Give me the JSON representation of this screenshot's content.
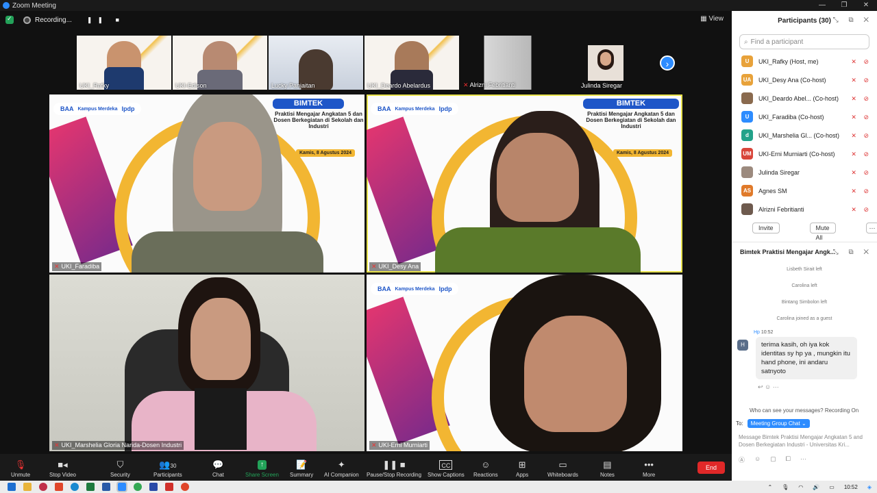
{
  "window": {
    "title": "Zoom Meeting"
  },
  "topbar": {
    "recording_label": "Recording...",
    "view_label": "View"
  },
  "strip": [
    {
      "name": "UKI_Rafky"
    },
    {
      "name": "UKI-Edison"
    },
    {
      "name": "Lucky Panjaitan"
    },
    {
      "name": "UKI_Deardo Abelardus"
    },
    {
      "name": "Alrizni Febritianti"
    },
    {
      "name": "Julinda Siregar"
    }
  ],
  "tiles": [
    {
      "name": "UKI_Faradiba"
    },
    {
      "name": "UKI_Desy Ana"
    },
    {
      "name": "UKI_Marshelia Gloria Narida-Dosen Industri"
    },
    {
      "name": "UKI-Erni Murniarti"
    }
  ],
  "slide": {
    "banner": "BIMTEK",
    "subtitle": "Praktisi Mengajar Angkatan 5 dan Dosen Berkegiatan di Sekolah dan Industri",
    "date": "Kamis, 8 Agustus 2024",
    "logo_baa": "BAA",
    "logo_km": "Kampus Merdeka",
    "logo_lpdp": "lpdp"
  },
  "participants": {
    "title": "Participants (30)",
    "search_placeholder": "Find a participant",
    "list": [
      {
        "initials": "U",
        "color": "#e8a23a",
        "name": "UKI_Rafky (Host, me)"
      },
      {
        "initials": "UA",
        "color": "#e8a23a",
        "name": "UKI_Desy Ana (Co-host)"
      },
      {
        "initials": "",
        "color": "#8a6a4e",
        "name": "UKI_Deardo Abel... (Co-host)"
      },
      {
        "initials": "U",
        "color": "#2d8cff",
        "name": "UKI_Faradiba (Co-host)"
      },
      {
        "initials": "d",
        "color": "#23a28a",
        "name": "UKI_Marshelia Gl... (Co-host)"
      },
      {
        "initials": "UM",
        "color": "#d8453a",
        "name": "UKI-Erni Murniarti (Co-host)"
      },
      {
        "initials": "",
        "color": "#9c8a7e",
        "name": "Julinda Siregar"
      },
      {
        "initials": "AS",
        "color": "#e07a2a",
        "name": "Agnes SM"
      },
      {
        "initials": "",
        "color": "#6e5a4e",
        "name": "Alrizni Febritianti"
      }
    ],
    "invite_label": "Invite",
    "mute_all_label": "Mute All"
  },
  "chat": {
    "title": "Bimtek Praktisi Mengajar Angk...",
    "system": [
      "Lisbeth Sirait left",
      "Carolina left",
      "Bintang Simbolon left",
      "Carolina joined as a guest"
    ],
    "message": {
      "sender": "Hp",
      "time": "10:52",
      "avatar": "H",
      "text": "terima kasih, oh iya kok identitas sy hp ya , mungkin itu hand phone, ini andaru satnyoto"
    },
    "who_can_see": "Who can see your messages? Recording On",
    "to_label": "To:",
    "to_target": "Meeting Group Chat",
    "compose_placeholder": "Message Bimtek Praktisi Mengajar Angkatan 5 and Dosen Berkegiatan Industri - Universitas Kri..."
  },
  "toolbar": {
    "unmute": "Unmute",
    "stop_video": "Stop Video",
    "security": "Security",
    "participants": "Participants",
    "participants_count": "30",
    "chat": "Chat",
    "share_screen": "Share Screen",
    "summary": "Summary",
    "ai_companion": "AI Companion",
    "pause_recording": "Pause/Stop Recording",
    "captions": "Show Captions",
    "reactions": "Reactions",
    "apps": "Apps",
    "whiteboards": "Whiteboards",
    "notes": "Notes",
    "more": "More",
    "end": "End"
  },
  "taskbar": {
    "clock": "10:52"
  },
  "colors": {
    "accent": "#2d8cff",
    "end": "#e02828",
    "share": "#23a259",
    "speaker_border": "#e8e24a"
  }
}
